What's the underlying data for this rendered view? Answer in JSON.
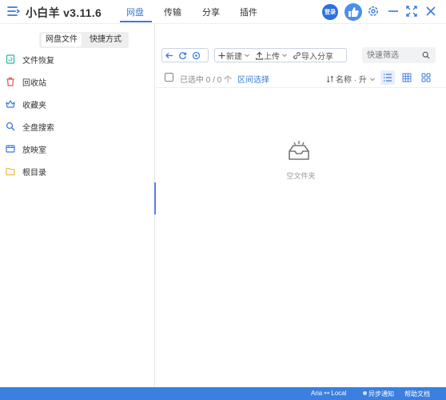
{
  "header": {
    "app_name": "小白羊 v3.11.6",
    "tabs": [
      {
        "label": "网盘",
        "active": true
      },
      {
        "label": "传输",
        "active": false
      },
      {
        "label": "分享",
        "active": false
      },
      {
        "label": "插件",
        "active": false
      }
    ],
    "login_label": "登录"
  },
  "sidebar": {
    "segments": [
      {
        "label": "网盘文件",
        "active": true
      },
      {
        "label": "快捷方式",
        "active": false
      }
    ],
    "items": [
      {
        "label": "文件恢复",
        "icon": "file-restore-icon",
        "color": "#2bb5a5"
      },
      {
        "label": "回收站",
        "icon": "trash-icon",
        "color": "#e5544b"
      },
      {
        "label": "收藏夹",
        "icon": "favorites-icon",
        "color": "#3a7bd5"
      },
      {
        "label": "全盘搜索",
        "icon": "search-icon",
        "color": "#3a7bd5"
      },
      {
        "label": "放映室",
        "icon": "screening-room-icon",
        "color": "#3a7bd5"
      },
      {
        "label": "根目录",
        "icon": "folder-icon",
        "color": "#f0b94a"
      }
    ]
  },
  "toolbar": {
    "new_label": "新建",
    "upload_label": "上传",
    "import_share_label": "导入分享",
    "filter_placeholder": "快速筛选"
  },
  "list_header": {
    "selected_text": "已选中 0 / 0 个",
    "range_select_label": "区间选择",
    "sort_label": "名称 · 升"
  },
  "content": {
    "empty_text": "空文件夹"
  },
  "statusbar": {
    "aria": "Aria ⚯ Local",
    "async_notify": "异步通知",
    "help_docs": "帮助文档"
  },
  "colors": {
    "accent": "#3a7bd5",
    "statusbar": "#3b7fe0"
  }
}
